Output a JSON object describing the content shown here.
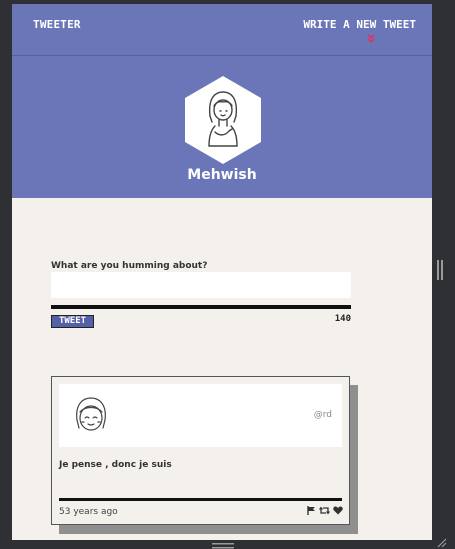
{
  "nav": {
    "brand": "TWEETER",
    "compose": "WRITE A NEW TWEET",
    "compose_icon": "chevron-double-down-icon"
  },
  "profile": {
    "name": "Mehwish",
    "avatar_icon": "user-avatar-icon"
  },
  "compose_form": {
    "label": "What are you humming about?",
    "input_value": "",
    "submit_label": "TWEET",
    "char_count": "140"
  },
  "tweets": [
    {
      "handle": "@rd",
      "text": "Je pense , donc je suis",
      "time": "53 years ago",
      "actions": [
        "flag-icon",
        "retweet-icon",
        "heart-icon"
      ]
    }
  ],
  "colors": {
    "header": "#6a76b8",
    "accent": "#e2325a",
    "background": "#f4f1ec",
    "button": "#5561a6"
  }
}
